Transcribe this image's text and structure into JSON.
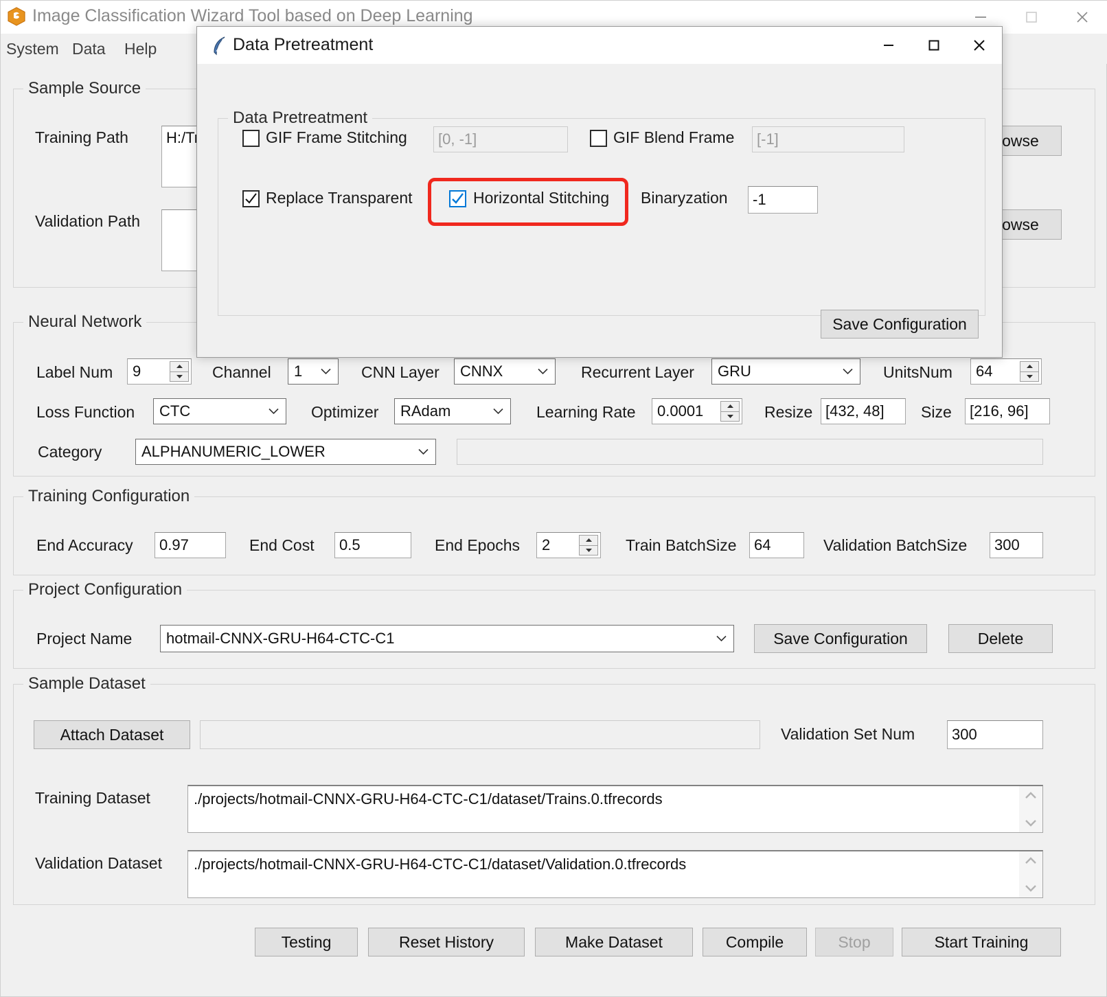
{
  "main_window": {
    "title": "Image Classification Wizard Tool based on Deep Learning",
    "icon": "app-logo-icon",
    "controls": {
      "minimize": "minimize-icon",
      "maximize": "maximize-icon",
      "close": "close-icon"
    },
    "menu": [
      {
        "label": "System"
      },
      {
        "label": "Data"
      },
      {
        "label": "Help"
      }
    ]
  },
  "sample_source": {
    "title": "Sample Source",
    "training_path_label": "Training Path",
    "training_path_value": "H:/Tr",
    "validation_path_label": "Validation Path",
    "validation_path_value": "",
    "browse_training_label": "owse",
    "browse_validation_label": "owse"
  },
  "neural_network": {
    "title": "Neural Network",
    "label_num_label": "Label Num",
    "label_num_value": "9",
    "channel_label": "Channel",
    "channel_value": "1",
    "cnn_layer_label": "CNN Layer",
    "cnn_layer_value": "CNNX",
    "recurrent_layer_label": "Recurrent Layer",
    "recurrent_layer_value": "GRU",
    "units_num_label": "UnitsNum",
    "units_num_value": "64",
    "loss_function_label": "Loss Function",
    "loss_function_value": "CTC",
    "optimizer_label": "Optimizer",
    "optimizer_value": "RAdam",
    "learning_rate_label": "Learning Rate",
    "learning_rate_value": "0.0001",
    "resize_label": "Resize",
    "resize_value": "[432, 48]",
    "size_label": "Size",
    "size_value": "[216, 96]",
    "category_label": "Category",
    "category_value": "ALPHANUMERIC_LOWER",
    "category_extra_value": ""
  },
  "training_configuration": {
    "title": "Training Configuration",
    "end_accuracy_label": "End Accuracy",
    "end_accuracy_value": "0.97",
    "end_cost_label": "End Cost",
    "end_cost_value": "0.5",
    "end_epochs_label": "End Epochs",
    "end_epochs_value": "2",
    "train_batchsize_label": "Train BatchSize",
    "train_batchsize_value": "64",
    "validation_batchsize_label": "Validation BatchSize",
    "validation_batchsize_value": "300"
  },
  "project_configuration": {
    "title": "Project Configuration",
    "project_name_label": "Project Name",
    "project_name_value": "hotmail-CNNX-GRU-H64-CTC-C1",
    "save_label": "Save Configuration",
    "delete_label": "Delete"
  },
  "sample_dataset": {
    "title": "Sample Dataset",
    "attach_dataset_label": "Attach Dataset",
    "attach_dataset_value": "",
    "validation_set_num_label": "Validation Set Num",
    "validation_set_num_value": "300",
    "training_dataset_label": "Training Dataset",
    "training_dataset_value": "./projects/hotmail-CNNX-GRU-H64-CTC-C1/dataset/Trains.0.tfrecords",
    "validation_dataset_label": "Validation Dataset",
    "validation_dataset_value": "./projects/hotmail-CNNX-GRU-H64-CTC-C1/dataset/Validation.0.tfrecords"
  },
  "bottom_bar": {
    "buttons": [
      {
        "label": "Testing",
        "enabled": true
      },
      {
        "label": "Reset History",
        "enabled": true
      },
      {
        "label": "Make Dataset",
        "enabled": true
      },
      {
        "label": "Compile",
        "enabled": true
      },
      {
        "label": "Stop",
        "enabled": false
      },
      {
        "label": "Start Training",
        "enabled": true
      }
    ]
  },
  "dialog": {
    "title": "Data Pretreatment",
    "icon": "feather-icon",
    "controls": {
      "minimize": "minimize-icon",
      "maximize": "maximize-icon",
      "close": "close-icon"
    },
    "group_title": "Data Pretreatment",
    "gif_frame_stitching_label": "GIF Frame Stitching",
    "gif_frame_stitching_checked": false,
    "gif_frame_stitching_value": "[0, -1]",
    "gif_blend_frame_label": "GIF Blend Frame",
    "gif_blend_frame_checked": false,
    "gif_blend_frame_value": "[-1]",
    "replace_transparent_label": "Replace Transparent",
    "replace_transparent_checked": true,
    "horizontal_stitching_label": "Horizontal Stitching",
    "horizontal_stitching_checked": true,
    "binaryzation_label": "Binaryzation",
    "binaryzation_value": "-1",
    "save_configuration_label": "Save Configuration"
  },
  "colors": {
    "highlight_red": "#f0281e",
    "checkbox_blue": "#0078d7",
    "window_bg": "#f0f0f0"
  }
}
